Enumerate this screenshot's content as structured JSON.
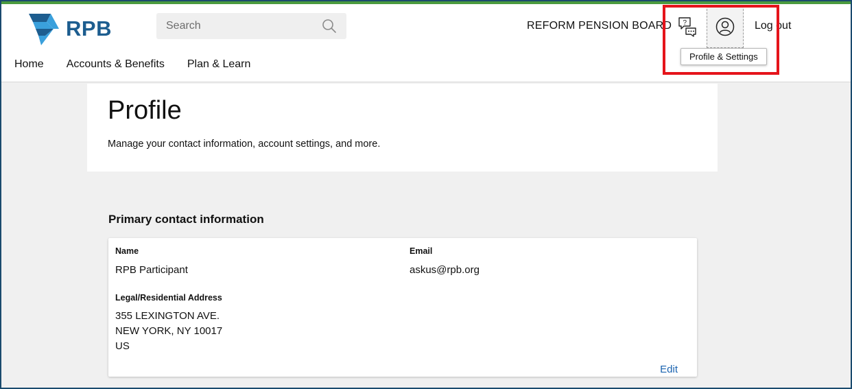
{
  "header": {
    "brand": "RPB",
    "search_placeholder": "Search",
    "org_name": "REFORM PENSION BOARD",
    "logout_label": "Log out",
    "profile_tooltip": "Profile & Settings",
    "icons": {
      "logo": "star-logo-icon",
      "search": "search-icon",
      "help": "help-chat-icon",
      "profile": "user-profile-icon"
    },
    "colors": {
      "accent_bar": "#4a9a3e",
      "brand": "#1d5d8f",
      "logo_light": "#3aa0dc",
      "highlight": "#e5141b"
    }
  },
  "nav": {
    "items": [
      {
        "label": "Home"
      },
      {
        "label": "Accounts & Benefits"
      },
      {
        "label": "Plan & Learn"
      }
    ]
  },
  "profile": {
    "title": "Profile",
    "subtitle": "Manage your contact information, account settings, and more."
  },
  "contact": {
    "section_title": "Primary contact information",
    "name_label": "Name",
    "name_value": "RPB Participant",
    "email_label": "Email",
    "email_value": "askus@rpb.org",
    "address_label": "Legal/Residential Address",
    "address_lines": [
      "355 LEXINGTON AVE.",
      "NEW YORK, NY 10017",
      "US"
    ],
    "edit_label": "Edit",
    "link_color": "#1a63b0"
  }
}
